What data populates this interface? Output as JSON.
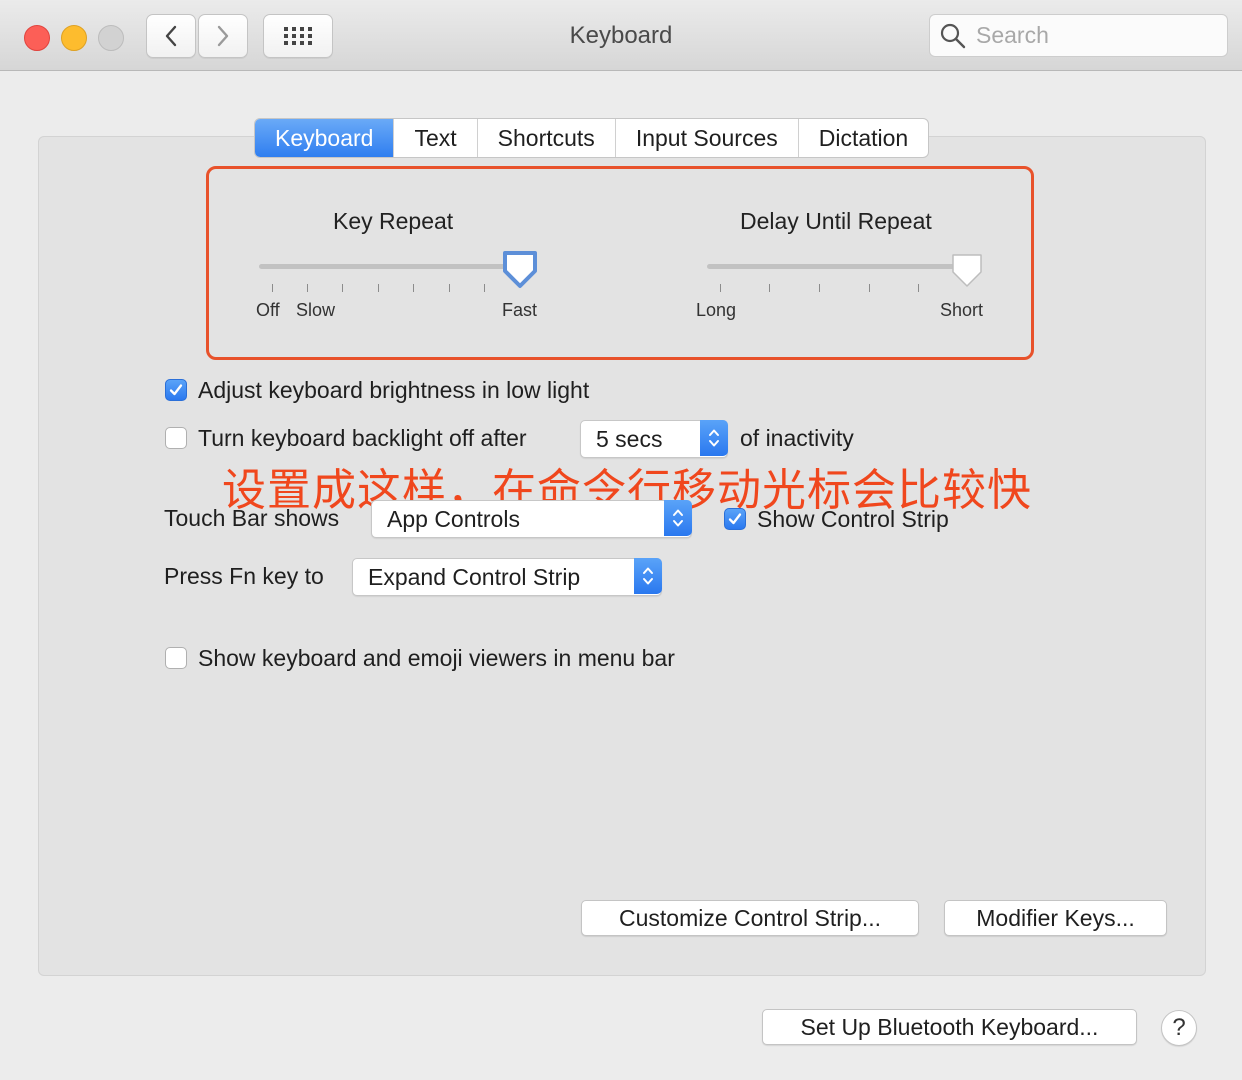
{
  "window": {
    "title": "Keyboard"
  },
  "toolbar": {
    "search_placeholder": "Search"
  },
  "tabs": [
    {
      "label": "Keyboard",
      "active": true
    },
    {
      "label": "Text",
      "active": false
    },
    {
      "label": "Shortcuts",
      "active": false
    },
    {
      "label": "Input Sources",
      "active": false
    },
    {
      "label": "Dictation",
      "active": false
    }
  ],
  "key_repeat": {
    "title": "Key Repeat",
    "labels": {
      "off": "Off",
      "slow": "Slow",
      "fast": "Fast"
    },
    "level": 0.95
  },
  "delay_until_repeat": {
    "title": "Delay Until Repeat",
    "labels": {
      "long": "Long",
      "short": "Short"
    },
    "level": 1.0
  },
  "options": {
    "adjust_brightness": {
      "label": "Adjust keyboard brightness in low light",
      "checked": true
    },
    "backlight_off": {
      "label": "Turn keyboard backlight off after",
      "checked": false,
      "value": "5 secs",
      "suffix": "of inactivity"
    },
    "touch_bar": {
      "label": "Touch Bar shows",
      "value": "App Controls"
    },
    "show_control_strip": {
      "label": "Show Control Strip",
      "checked": true
    },
    "press_fn": {
      "label": "Press Fn key to",
      "value": "Expand Control Strip"
    },
    "show_viewers": {
      "label": "Show keyboard and emoji viewers in menu bar",
      "checked": false
    }
  },
  "annotation": "设置成这样，在命令行移动光标会比较快",
  "buttons": {
    "customize_control_strip": "Customize Control Strip...",
    "modifier_keys": "Modifier Keys...",
    "bluetooth": "Set Up Bluetooth Keyboard...",
    "help": "?"
  },
  "colors": {
    "accent": "#2f7ef0",
    "annotation": "#f0471d"
  }
}
